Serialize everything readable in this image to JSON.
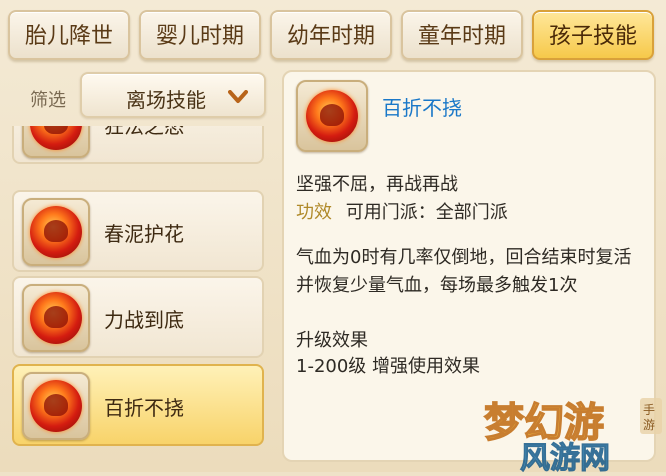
{
  "tabs": [
    {
      "label": "胎儿降世",
      "active": false
    },
    {
      "label": "婴儿时期",
      "active": false
    },
    {
      "label": "幼年时期",
      "active": false
    },
    {
      "label": "童年时期",
      "active": false
    },
    {
      "label": "孩子技能",
      "active": true
    }
  ],
  "filter": {
    "label": "筛选",
    "selected": "离场技能"
  },
  "skills": [
    {
      "label": "狂法之怒",
      "icon": "rage-flame-icon"
    },
    {
      "label": "春泥护花",
      "icon": "flower-heart-icon"
    },
    {
      "label": "力战到底",
      "icon": "fight-flame-icon"
    },
    {
      "label": "百折不挠",
      "icon": "resilience-flame-icon",
      "active": true
    }
  ],
  "detail": {
    "name": "百折不挠",
    "icon": "resilience-flame-icon",
    "subtitle": "坚强不屈，再战再战",
    "effect_label": "功效",
    "effect_text": "可用门派：全部门派",
    "description": "气血为0时有几率仅倒地，回合结束时复活并恢复少量气血，每场最多触发1次",
    "upgrade_label": "升级效果",
    "upgrade_text": "1-200级 增强使用效果"
  },
  "watermark": {
    "text": "梦幻游",
    "sub": "风游网",
    "tag": "手游"
  },
  "colors": {
    "active_tab": "#f6c94a",
    "skill_name": "#1a78c8",
    "accent_gold": "#b08a2a"
  }
}
